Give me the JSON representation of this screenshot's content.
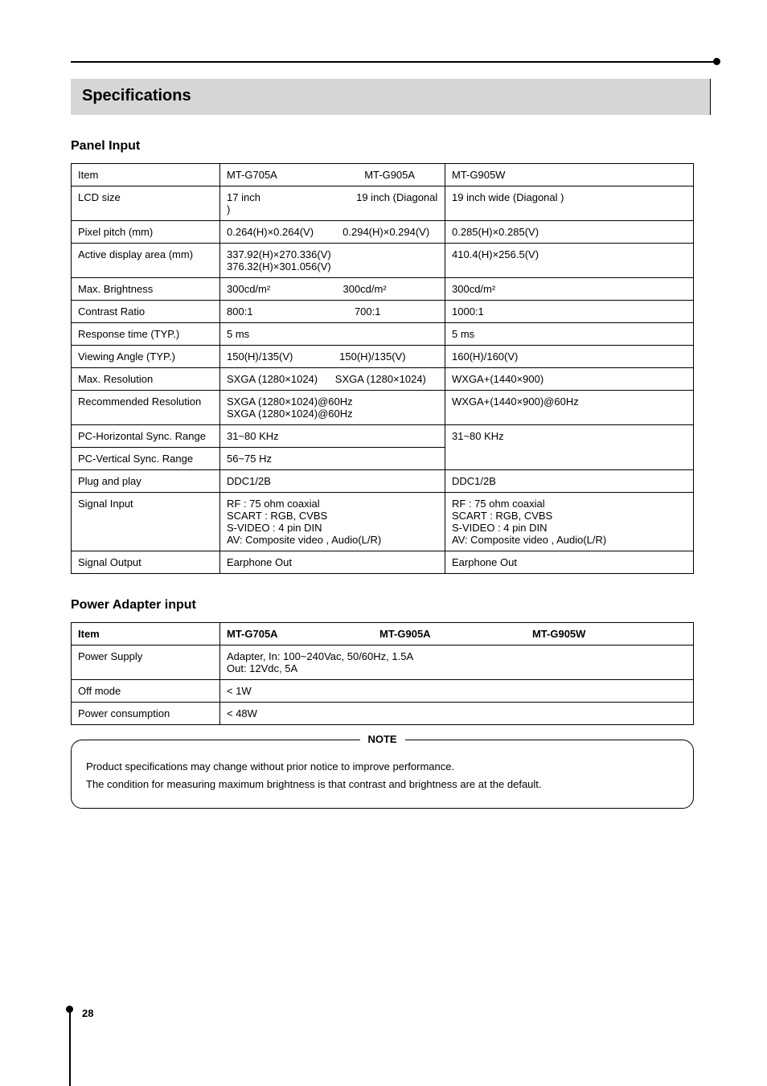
{
  "section_title": "Specifications",
  "table1": {
    "heading": "Panel Input",
    "headers": [
      "Item",
      "MT-G705A                              MT-G905A",
      "MT-G905W"
    ],
    "rows": [
      {
        "c1": "LCD size",
        "c2": "17 inch                                 19 inch (Diagonal )",
        "c3": "19 inch wide (Diagonal )"
      },
      {
        "c1": "Pixel pitch (mm)",
        "c2": "0.264(H)×0.264(V)          0.294(H)×0.294(V)",
        "c3": "0.285(H)×0.285(V)"
      },
      {
        "c1": "Active display area (mm)",
        "c2": "337.92(H)×270.336(V)\n376.32(H)×301.056(V)",
        "c3": "410.4(H)×256.5(V)"
      },
      {
        "c1": "Max. Brightness",
        "c2": "300cd/m²                         300cd/m²",
        "c3": "300cd/m²"
      },
      {
        "c1": "Contrast Ratio",
        "c2": "800:1                                   700:1",
        "c3": "1000:1"
      },
      {
        "c1": "Response time (TYP.)",
        "c2": "5 ms",
        "c3": "5 ms"
      },
      {
        "c1": "Viewing Angle (TYP.)",
        "c2": "150(H)/135(V)                150(H)/135(V)",
        "c3": "160(H)/160(V)"
      },
      {
        "c1": "Max. Resolution",
        "c2": "SXGA (1280×1024)      SXGA (1280×1024)",
        "c3": "WXGA+(1440×900)"
      },
      {
        "c1": "Recommended Resolution",
        "c2": "SXGA (1280×1024)@60Hz\nSXGA (1280×1024)@60Hz",
        "c3": "WXGA+(1440×900)@60Hz"
      },
      {
        "c1": "PC-Horizontal Sync. Range",
        "c2": "31~80 KHz",
        "c3": "31~80 KHz",
        "rowspan_c3": 2
      },
      {
        "c1": "PC-Vertical Sync. Range",
        "c2": "56~75 Hz"
      },
      {
        "c1": "Plug and play",
        "c2": "DDC1/2B",
        "c3": "DDC1/2B"
      },
      {
        "c1": "Signal Input",
        "c2": "RF : 75 ohm coaxial\nSCART : RGB, CVBS\nS-VIDEO : 4 pin DIN\nAV: Composite video , Audio(L/R)",
        "c3": "RF : 75 ohm coaxial\nSCART : RGB, CVBS\nS-VIDEO : 4 pin DIN\nAV: Composite video , Audio(L/R)"
      },
      {
        "c1": "Signal Output",
        "c2": "Earphone Out",
        "c3": "Earphone Out"
      }
    ]
  },
  "table2": {
    "heading": "Power Adapter input",
    "headers": [
      "Item",
      "MT-G705A                                   MT-G905A                                   MT-G905W"
    ],
    "rows": [
      {
        "c1": "Power Supply",
        "c2": "Adapter, In: 100~240Vac, 50/60Hz, 1.5A\nOut: 12Vdc, 5A"
      },
      {
        "c1": "Off mode",
        "c2": "< 1W"
      },
      {
        "c1": "Power consumption",
        "c2": "< 48W"
      }
    ]
  },
  "callout": {
    "label": "NOTE",
    "lines": [
      "Product specifications may change without prior notice to improve performance.",
      "The condition for measuring maximum brightness is that contrast and brightness are at the default."
    ]
  },
  "page_number": "28"
}
